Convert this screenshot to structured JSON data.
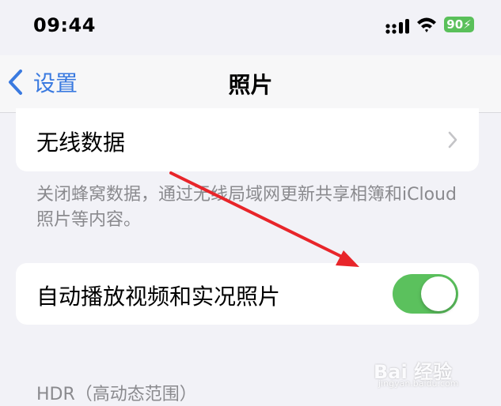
{
  "status_bar": {
    "time": "09:44",
    "battery": "90",
    "icons": [
      "cellular-signal-icon",
      "wifi-icon",
      "battery-charging-icon"
    ]
  },
  "nav": {
    "back_label": "设置",
    "title": "照片"
  },
  "wireless_data": {
    "label": "无线数据",
    "footer": "关闭蜂窝数据，通过无线局域网更新共享相簿和iCloud照片等内容。"
  },
  "autoplay": {
    "label": "自动播放视频和实况照片",
    "enabled": true
  },
  "hdr": {
    "header": "HDR（高动态范围）"
  },
  "watermark": {
    "text": "Bai 经验",
    "sub": "jingyan.baidu.com"
  },
  "colors": {
    "accent": "#3a7ae0",
    "toggle_on": "#5bc15d",
    "background": "#f2f2f7",
    "annotation_arrow": "#e8252a"
  }
}
